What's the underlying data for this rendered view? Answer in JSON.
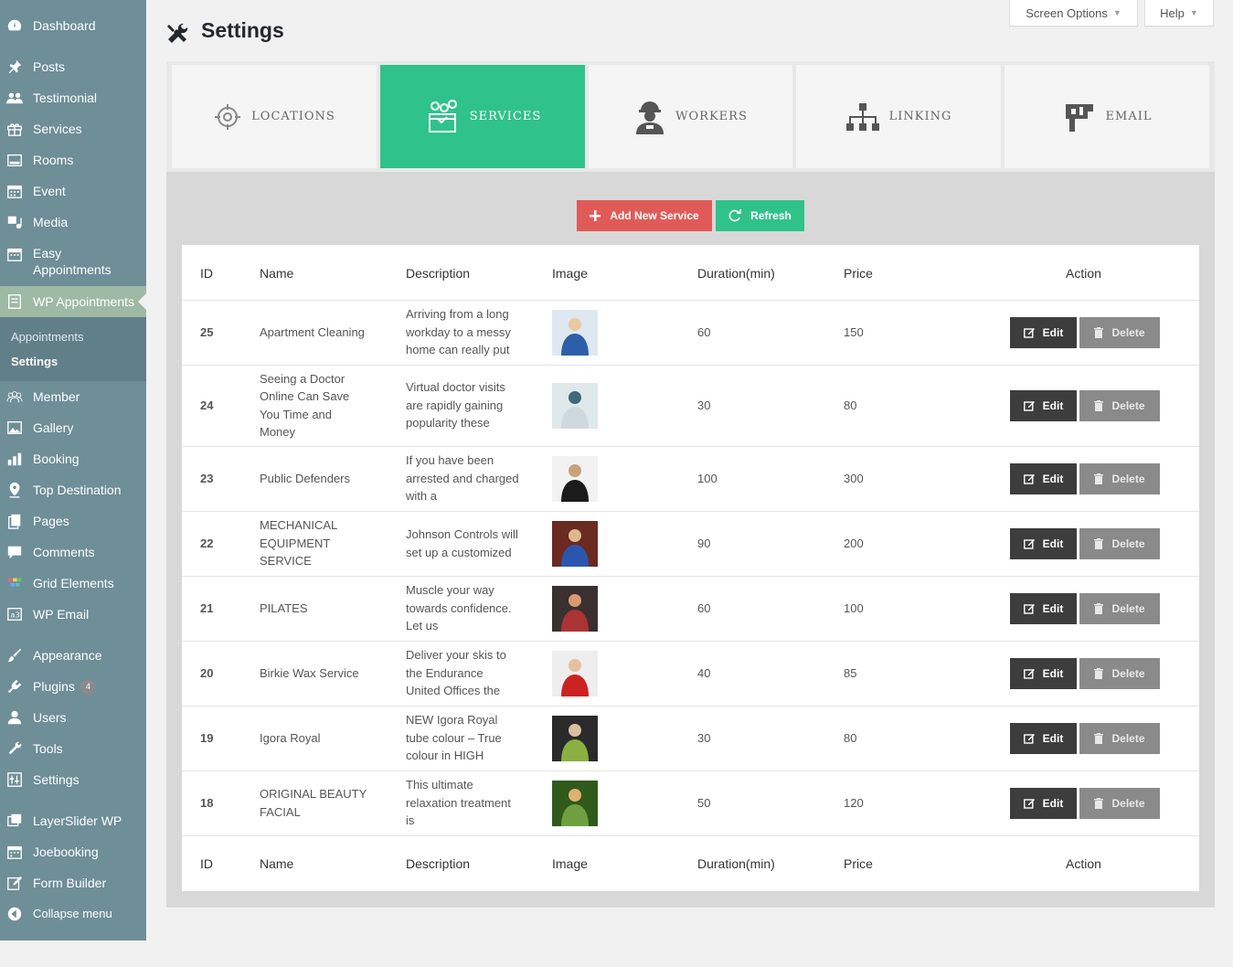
{
  "sidebar": {
    "items": [
      {
        "label": "Dashboard",
        "icon": "dashboard-icon"
      },
      {
        "label": "Posts",
        "icon": "pin-icon"
      },
      {
        "label": "Testimonial",
        "icon": "people-icon"
      },
      {
        "label": "Services",
        "icon": "gift-icon"
      },
      {
        "label": "Rooms",
        "icon": "room-icon"
      },
      {
        "label": "Event",
        "icon": "calendar-icon"
      },
      {
        "label": "Media",
        "icon": "media-icon"
      },
      {
        "label": "Easy Appointments",
        "icon": "calendar-icon"
      },
      {
        "label": "WP Appointments",
        "icon": "appointments-icon"
      },
      {
        "label": "Member",
        "icon": "members-icon"
      },
      {
        "label": "Gallery",
        "icon": "image-icon"
      },
      {
        "label": "Booking",
        "icon": "chart-icon"
      },
      {
        "label": "Top Destination",
        "icon": "location-icon"
      },
      {
        "label": "Pages",
        "icon": "pages-icon"
      },
      {
        "label": "Comments",
        "icon": "comment-icon"
      },
      {
        "label": "Grid Elements",
        "icon": "grid-icon"
      },
      {
        "label": "WP Email",
        "icon": "email-icon"
      },
      {
        "label": "Appearance",
        "icon": "brush-icon"
      },
      {
        "label": "Plugins",
        "icon": "plugin-icon",
        "badge": "4"
      },
      {
        "label": "Users",
        "icon": "user-icon"
      },
      {
        "label": "Tools",
        "icon": "wrench-icon"
      },
      {
        "label": "Settings",
        "icon": "settings-icon"
      },
      {
        "label": "LayerSlider WP",
        "icon": "layers-icon"
      },
      {
        "label": "Joebooking",
        "icon": "calendar-icon"
      },
      {
        "label": "Form Builder",
        "icon": "form-icon"
      },
      {
        "label": "Collapse menu",
        "icon": "collapse-icon"
      }
    ],
    "submenu": [
      "Appointments",
      "Settings"
    ]
  },
  "header": {
    "title": "Settings",
    "screen_options": "Screen Options",
    "help": "Help"
  },
  "tabs": [
    {
      "label": "LOCATIONS",
      "icon": "target-icon"
    },
    {
      "label": "SERVICES",
      "icon": "services-box-icon"
    },
    {
      "label": "WORKERS",
      "icon": "worker-icon"
    },
    {
      "label": "LINKING",
      "icon": "hierarchy-icon"
    },
    {
      "label": "EMAIL",
      "icon": "mailbox-icon"
    }
  ],
  "actions": {
    "add": "Add New Service",
    "refresh": "Refresh"
  },
  "table": {
    "headers": [
      "ID",
      "Name",
      "Description",
      "Image",
      "Duration(min)",
      "Price",
      "Action"
    ],
    "edit_label": "Edit",
    "delete_label": "Delete",
    "rows": [
      {
        "id": "25",
        "name": "Apartment Cleaning",
        "description": "Arriving from a long workday to a messy home can really put",
        "duration": "60",
        "price": "150"
      },
      {
        "id": "24",
        "name": "Seeing a Doctor Online Can Save You Time and Money",
        "description": "Virtual doctor visits are rapidly gaining popularity these",
        "duration": "30",
        "price": "80"
      },
      {
        "id": "23",
        "name": "Public Defenders",
        "description": "If you have been arrested and charged with a",
        "duration": "100",
        "price": "300"
      },
      {
        "id": "22",
        "name": "MECHANICAL EQUIPMENT SERVICE",
        "description": "Johnson Controls will set up a customized",
        "duration": "90",
        "price": "200"
      },
      {
        "id": "21",
        "name": "PILATES",
        "description": "Muscle your way towards confidence. Let us",
        "duration": "60",
        "price": "100"
      },
      {
        "id": "20",
        "name": "Birkie Wax Service",
        "description": "Deliver your skis to the Endurance United Offices the",
        "duration": "40",
        "price": "85"
      },
      {
        "id": "19",
        "name": "Igora Royal",
        "description": "NEW Igora Royal tube colour – True colour in HIGH",
        "duration": "30",
        "price": "80"
      },
      {
        "id": "18",
        "name": "ORIGINAL BEAUTY FACIAL",
        "description": "This ultimate relaxation treatment is",
        "duration": "50",
        "price": "120"
      }
    ]
  },
  "colors": {
    "sidebar": "#6e8e98",
    "accent": "#30c28b",
    "add_button": "#e05b58",
    "edit_button": "#3d3d3d",
    "delete_button": "#8a8a8a"
  }
}
